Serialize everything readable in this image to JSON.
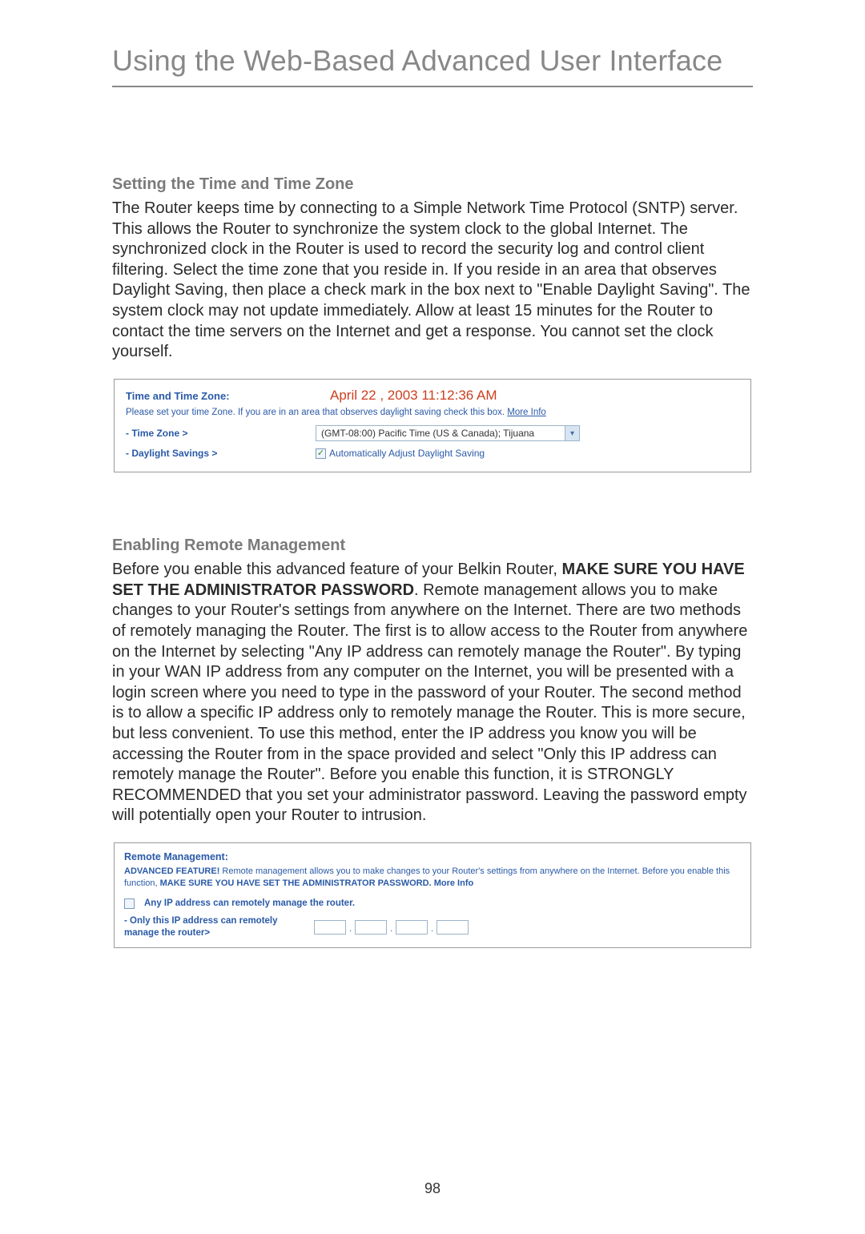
{
  "page": {
    "title": "Using the Web-Based Advanced User Interface",
    "number": "98"
  },
  "section1": {
    "heading": "Setting the Time and Time Zone",
    "body": "The Router keeps time by connecting to a Simple Network Time Protocol (SNTP) server. This allows the Router to synchronize the system clock to the global Internet. The synchronized clock in the Router is used to record the security log and control client filtering. Select the time zone that you reside in. If you reside in an area that observes Daylight Saving, then place a check mark in the box next to \"Enable Daylight Saving\". The system clock may not update immediately. Allow at least 15 minutes for the Router to contact the time servers on the Internet and get a response. You cannot set the clock yourself."
  },
  "timezone_figure": {
    "header_label": "Time and Time Zone:",
    "datetime": "April 22 , 2003   11:12:36 AM",
    "note_prefix": "Please set your time Zone. If you are in an area that observes daylight saving check this box. ",
    "note_link": "More Info",
    "row_tz_label": "- Time Zone >",
    "tz_selected": "(GMT-08:00) Pacific Time (US & Canada); Tijuana",
    "row_ds_label": "- Daylight Savings >",
    "ds_checked": true,
    "ds_text": "Automatically Adjust Daylight Saving"
  },
  "section2": {
    "heading": "Enabling Remote Management",
    "body_pre": "Before you enable this advanced feature of your Belkin Router, ",
    "body_bold": "MAKE SURE YOU HAVE SET THE ADMINISTRATOR PASSWORD",
    "body_post": ". Remote management allows you to make changes to your Router's settings from anywhere on the Internet. There are two methods of remotely managing the Router. The first is to allow access to the Router from anywhere on the Internet by selecting \"Any IP address can remotely manage the Router\". By typing in your WAN IP address from any computer on the Internet, you will be presented with a login screen where you need to type in the password of your Router. The second method is to allow a specific IP address only to remotely manage the Router. This is more secure, but less convenient. To use this method, enter the IP address you know you will be accessing the Router from in the space provided and select \"Only this IP address can remotely manage the Router\". Before you enable this function, it is STRONGLY RECOMMENDED that you set your administrator password. Leaving the password empty will potentially open your Router to intrusion."
  },
  "remote_figure": {
    "header": "Remote Management:",
    "note_bold1": "ADVANCED FEATURE!",
    "note_mid": " Remote management allows you to make changes to your Router's settings from anywhere on the Internet. Before you enable this function, ",
    "note_bold2": "MAKE SURE YOU HAVE SET THE ADMINISTRATOR PASSWORD.",
    "note_link": "More Info",
    "anyip_checked": false,
    "anyip_label": "Any IP address can remotely manage the router.",
    "onlyip_label": "- Only this IP address can remotely manage the router>",
    "ip": [
      "",
      "",
      "",
      ""
    ]
  }
}
